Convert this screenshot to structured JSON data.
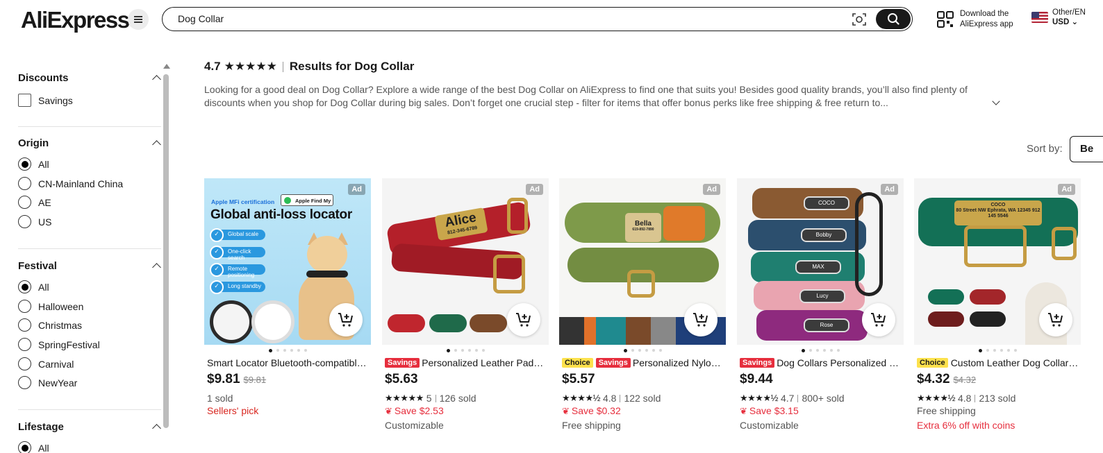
{
  "header": {
    "logo": "AliExpress",
    "search_value": "Dog Collar",
    "download_line1": "Download the",
    "download_line2": "AliExpress app",
    "locale_line1": "Other/EN",
    "currency": "USD"
  },
  "sidebar": {
    "discounts": {
      "title": "Discounts",
      "options": [
        "Savings"
      ]
    },
    "origin": {
      "title": "Origin",
      "options": [
        "All",
        "CN-Mainland China",
        "AE",
        "US"
      ],
      "selected": "All"
    },
    "festival": {
      "title": "Festival",
      "options": [
        "All",
        "Halloween",
        "Christmas",
        "SpringFestival",
        "Carnival",
        "NewYear"
      ],
      "selected": "All"
    },
    "lifestage": {
      "title": "Lifestage",
      "options": [
        "All"
      ]
    }
  },
  "main": {
    "rating": "4.7",
    "stars": "★★★★★",
    "results_title": "Results for Dog Collar",
    "description": "Looking for a good deal on Dog Collar? Explore a wide range of the best Dog Collar on AliExpress to find one that suits you! Besides good quality brands, you’ll also find plenty of discounts when you shop for Dog Collar during big sales. Don’t forget one crucial step - filter for items that offer bonus perks like free shipping & free return to...",
    "sort_label": "Sort by:",
    "sort_value": "Be"
  },
  "products": [
    {
      "ad": "Ad",
      "choice": "",
      "savings": "",
      "title": "Smart Locator Bluetooth-compatible Anti-Loss Tracker",
      "price": "$9.81",
      "old_price": "$9.81",
      "stars": "",
      "rating": "",
      "sold": "1 sold",
      "save": "",
      "extra": "Sellers' pick",
      "extra2": "",
      "image_text": {
        "cert": "Apple MFi certification",
        "findmy": "Apple Find My",
        "headline": "Global anti-loss locator",
        "pills": [
          "Global scale",
          "One-click search",
          "Remote positioning",
          "Long standby"
        ]
      }
    },
    {
      "ad": "Ad",
      "choice": "",
      "savings": "Savings",
      "title": "Personalized Leather Padded Dog Collar",
      "price": "$5.63",
      "old_price": "",
      "stars": "★★★★★",
      "rating": "5",
      "sold": "126 sold",
      "save": "Save $2.53",
      "extra": "Customizable",
      "extra2": "",
      "image_text": {
        "plate": "Alice",
        "plate_sub": "812-345-6789"
      }
    },
    {
      "ad": "Ad",
      "choice": "Choice",
      "savings": "Savings",
      "title": "Personalized Nylon Dog Collar",
      "price": "$5.57",
      "old_price": "",
      "stars": "★★★★½",
      "rating": "4.8",
      "sold": "122 sold",
      "save": "Save $0.32",
      "extra": "Free shipping",
      "extra2": "",
      "image_text": {
        "plate": "Bella",
        "plate_sub": "619-892-7890"
      }
    },
    {
      "ad": "Ad",
      "choice": "",
      "savings": "Savings",
      "title": "Dog Collars Personalized Custom Leather",
      "price": "$9.44",
      "old_price": "",
      "stars": "★★★★½",
      "rating": "4.7",
      "sold": "800+ sold",
      "save": "Save $3.15",
      "extra": "Customizable",
      "extra2": "",
      "image_text": {
        "names": [
          "COCO",
          "Bobby",
          "MAX",
          "Lucy",
          "Rose"
        ]
      }
    },
    {
      "ad": "Ad",
      "choice": "Choice",
      "savings": "",
      "title": "Custom Leather Dog Collar Personalized",
      "price": "$4.32",
      "old_price": "$4.32",
      "stars": "★★★★½",
      "rating": "4.8",
      "sold": "213 sold",
      "save": "",
      "extra": "Free shipping",
      "extra2": "Extra 6% off with coins",
      "image_text": {
        "plate": "COCO",
        "plate_sub": "80 Street NW Ephrata, WA 12345 912 145 5546"
      }
    }
  ],
  "colors": {
    "accent_red": "#e62e3d",
    "choice_yellow": "#fde14c",
    "brand_dark": "#191919"
  }
}
